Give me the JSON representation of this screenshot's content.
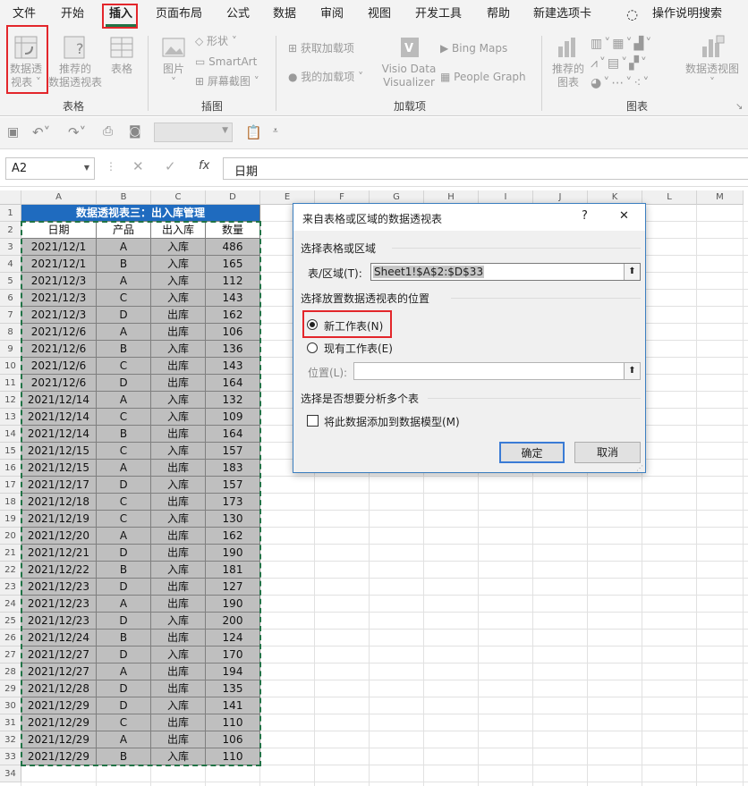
{
  "menu": [
    "文件",
    "开始",
    "插入",
    "页面布局",
    "公式",
    "数据",
    "审阅",
    "视图",
    "开发工具",
    "帮助",
    "新建选项卡"
  ],
  "tell_me": "操作说明搜索",
  "ribbon": {
    "pivot": "数据透\n视表 ˅",
    "rec_pivot": "推荐的\n数据透视表",
    "table": "表格",
    "group_table": "表格",
    "picture": "图片\n˅",
    "shapes": "形状 ˅",
    "smartart": "SmartArt",
    "screenshot": "屏幕截图 ˅",
    "group_illus": "插图",
    "get_addins": "获取加载项",
    "my_addins": "我的加载项 ˅",
    "visio": "Visio Data\nVisualizer",
    "bing": "Bing Maps",
    "people": "People Graph",
    "group_addins": "加载项",
    "rec_charts": "推荐的\n图表",
    "pivot_chart": "数据透视图\n˅",
    "group_charts": "图表"
  },
  "namebox": "A2",
  "fx": "fx",
  "formula": "日期",
  "columns": [
    "A",
    "B",
    "C",
    "D",
    "E",
    "F",
    "G",
    "H",
    "I",
    "J",
    "K",
    "L",
    "M"
  ],
  "title": "数据透视表三：出入库管理",
  "headers": [
    "日期",
    "产品",
    "出入库",
    "数量"
  ],
  "rows": [
    [
      "2021/12/1",
      "A",
      "入库",
      "486"
    ],
    [
      "2021/12/1",
      "B",
      "入库",
      "165"
    ],
    [
      "2021/12/3",
      "A",
      "入库",
      "112"
    ],
    [
      "2021/12/3",
      "C",
      "入库",
      "143"
    ],
    [
      "2021/12/3",
      "D",
      "出库",
      "162"
    ],
    [
      "2021/12/6",
      "A",
      "出库",
      "106"
    ],
    [
      "2021/12/6",
      "B",
      "入库",
      "136"
    ],
    [
      "2021/12/6",
      "C",
      "出库",
      "143"
    ],
    [
      "2021/12/6",
      "D",
      "出库",
      "164"
    ],
    [
      "2021/12/14",
      "A",
      "入库",
      "132"
    ],
    [
      "2021/12/14",
      "C",
      "入库",
      "109"
    ],
    [
      "2021/12/14",
      "B",
      "出库",
      "164"
    ],
    [
      "2021/12/15",
      "C",
      "入库",
      "157"
    ],
    [
      "2021/12/15",
      "A",
      "出库",
      "183"
    ],
    [
      "2021/12/17",
      "D",
      "入库",
      "157"
    ],
    [
      "2021/12/18",
      "C",
      "出库",
      "173"
    ],
    [
      "2021/12/19",
      "C",
      "入库",
      "130"
    ],
    [
      "2021/12/20",
      "A",
      "出库",
      "162"
    ],
    [
      "2021/12/21",
      "D",
      "出库",
      "190"
    ],
    [
      "2021/12/22",
      "B",
      "入库",
      "181"
    ],
    [
      "2021/12/23",
      "D",
      "出库",
      "127"
    ],
    [
      "2021/12/23",
      "A",
      "出库",
      "190"
    ],
    [
      "2021/12/23",
      "D",
      "入库",
      "200"
    ],
    [
      "2021/12/24",
      "B",
      "出库",
      "124"
    ],
    [
      "2021/12/27",
      "D",
      "入库",
      "170"
    ],
    [
      "2021/12/27",
      "A",
      "出库",
      "194"
    ],
    [
      "2021/12/28",
      "D",
      "出库",
      "135"
    ],
    [
      "2021/12/29",
      "D",
      "入库",
      "141"
    ],
    [
      "2021/12/29",
      "C",
      "出库",
      "110"
    ],
    [
      "2021/12/29",
      "A",
      "出库",
      "106"
    ],
    [
      "2021/12/29",
      "B",
      "入库",
      "110"
    ]
  ],
  "row_numbers": [
    "1",
    "2",
    "3",
    "4",
    "5",
    "6",
    "7",
    "8",
    "9",
    "10",
    "11",
    "12",
    "13",
    "14",
    "15",
    "16",
    "17",
    "18",
    "19",
    "20",
    "21",
    "22",
    "23",
    "24",
    "25",
    "26",
    "27",
    "28",
    "29",
    "30",
    "31",
    "32",
    "33",
    "34"
  ],
  "dialog": {
    "title": "来自表格或区域的数据透视表",
    "help": "?",
    "close": "✕",
    "section1": "选择表格或区域",
    "range_label": "表/区域(T):",
    "range_value": "Sheet1!$A$2:$D$33",
    "section2": "选择放置数据透视表的位置",
    "opt_new": "新工作表(N)",
    "opt_existing": "现有工作表(E)",
    "location_label": "位置(L):",
    "location_value": "",
    "section3": "选择是否想要分析多个表",
    "checkbox_label": "将此数据添加到数据模型(M)",
    "ok": "确定",
    "cancel": "取消"
  },
  "colors": {
    "header_blue": "#1f6bbf",
    "highlight_red": "#e3262b",
    "range_green": "#217346"
  }
}
